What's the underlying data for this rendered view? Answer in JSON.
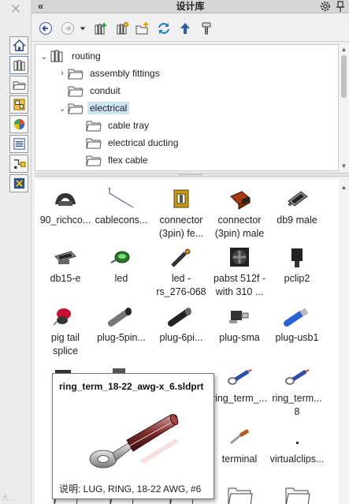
{
  "window": {
    "title": "设计库",
    "close_glyph": "✕",
    "collapse_glyph": "«"
  },
  "side_tabs": [
    {
      "icon": "home-icon"
    },
    {
      "icon": "design-library-icon"
    },
    {
      "icon": "file-explorer-icon"
    },
    {
      "icon": "view-palette-icon"
    },
    {
      "icon": "appearances-icon"
    },
    {
      "icon": "custom-properties-icon"
    },
    {
      "icon": "routing-library-icon"
    },
    {
      "icon": "solidworks-forum-icon"
    }
  ],
  "toolbar": {
    "buttons": [
      "back-icon",
      "forward-icon",
      "dropdown-arrow-icon",
      "add-to-library-icon",
      "add-file-location-icon",
      "create-new-folder-icon",
      "refresh-icon",
      "up-one-level-icon",
      "routing-library-manager-icon"
    ]
  },
  "tree": {
    "items": [
      {
        "label": "routing",
        "level": 0,
        "expander": "⌄"
      },
      {
        "label": "assembly fittings",
        "level": 1,
        "expander": "›"
      },
      {
        "label": "conduit",
        "level": 1,
        "expander": ""
      },
      {
        "label": "electrical",
        "level": 1,
        "expander": "⌄",
        "selected": true
      },
      {
        "label": "cable tray",
        "level": 2,
        "expander": ""
      },
      {
        "label": "electrical ducting",
        "level": 2,
        "expander": ""
      },
      {
        "label": "flex cable",
        "level": 2,
        "expander": ""
      }
    ]
  },
  "grid": {
    "items": [
      {
        "label": "90_richco...",
        "icon": "clip-part-icon"
      },
      {
        "label": "cablecons...",
        "icon": "cable-sketch-icon"
      },
      {
        "label": "connector (3pin) fe...",
        "icon": "connector-female-icon"
      },
      {
        "label": "connector (3pin) male",
        "icon": "connector-male-icon"
      },
      {
        "label": "db9 male",
        "icon": "db9-connector-icon"
      },
      {
        "label": "db15-e",
        "icon": "db15-connector-icon"
      },
      {
        "label": "led",
        "icon": "led-icon"
      },
      {
        "label": "led - rs_276-068",
        "icon": "led-rs-icon"
      },
      {
        "label": "pabst 512f - with 310 ...",
        "icon": "fan-icon"
      },
      {
        "label": "pclip2",
        "icon": "p-clip-icon"
      },
      {
        "label": "pig tail splice",
        "icon": "splice-icon"
      },
      {
        "label": "plug-5pin...",
        "icon": "plug-5pin-icon"
      },
      {
        "label": "plug-6pi...",
        "icon": "plug-6pin-icon"
      },
      {
        "label": "plug-sma",
        "icon": "plug-sma-icon"
      },
      {
        "label": "plug-usb1",
        "icon": "usb-plug-icon"
      },
      {
        "label": "plu",
        "icon": "plug-partial-icon"
      },
      {
        "label": "",
        "icon": "part-partial-icon"
      },
      {
        "label": "",
        "icon": "hidden-part-icon"
      },
      {
        "label": "ring_term_...",
        "icon": "ring-terminal-icon"
      },
      {
        "label": "ring_term... 8",
        "icon": "ring-terminal-icon"
      },
      {
        "label": "rj4",
        "icon": "rj45-icon"
      },
      {
        "label": "",
        "icon": "hidden-part-icon"
      },
      {
        "label": "",
        "icon": "hidden-part-icon"
      },
      {
        "label": "terminal",
        "icon": "terminal-icon"
      },
      {
        "label": "virtualclips...",
        "icon": "virtual-clip-icon"
      },
      {
        "label": "",
        "icon": "folder-icon"
      },
      {
        "label": "",
        "icon": "folder-icon"
      },
      {
        "label": "",
        "icon": "folder-icon"
      },
      {
        "label": "",
        "icon": "folder-icon"
      },
      {
        "label": "",
        "icon": "folder-icon"
      }
    ]
  },
  "tooltip": {
    "title": "ring_term_18-22_awg-x_6.sldprt",
    "description": "说明: LUG, RING, 18-22 AWG, #6",
    "image": "ring-terminal-preview-icon"
  },
  "watermark": "大 ..."
}
